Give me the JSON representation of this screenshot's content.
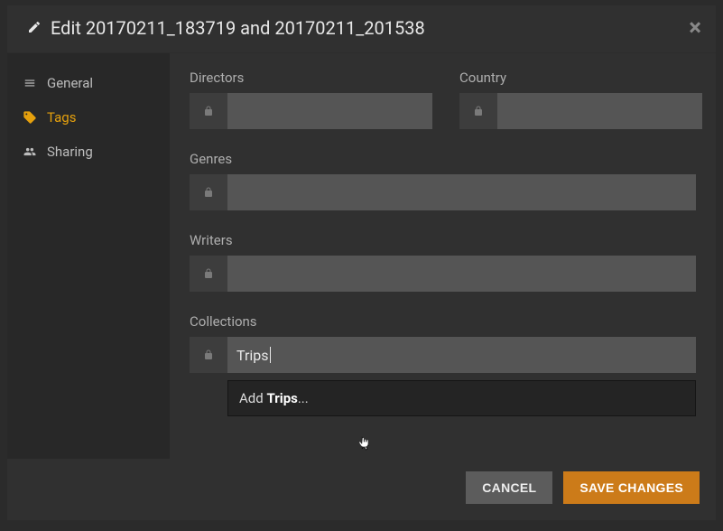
{
  "header": {
    "title": "Edit 20170211_183719 and 20170211_201538"
  },
  "sidebar": {
    "items": [
      {
        "label": "General"
      },
      {
        "label": "Tags"
      },
      {
        "label": "Sharing"
      }
    ],
    "active_index": 1
  },
  "fields": {
    "directors": {
      "label": "Directors",
      "value": ""
    },
    "country": {
      "label": "Country",
      "value": ""
    },
    "genres": {
      "label": "Genres",
      "value": ""
    },
    "writers": {
      "label": "Writers",
      "value": ""
    },
    "collections": {
      "label": "Collections",
      "value": "Trips"
    }
  },
  "dropdown": {
    "prefix": "Add ",
    "match": "Trips",
    "suffix": "..."
  },
  "footer": {
    "cancel": "CANCEL",
    "save": "SAVE CHANGES"
  }
}
